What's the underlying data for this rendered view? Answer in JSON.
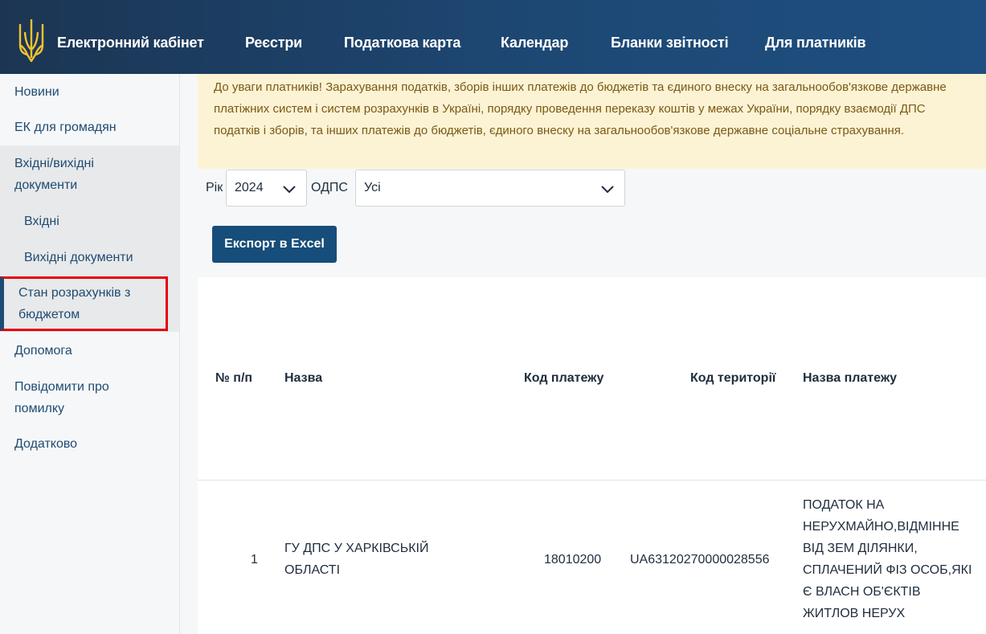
{
  "header": {
    "brand": "Електронний кабінет",
    "nav": [
      "Реєстри",
      "Податкова карта",
      "Календар",
      "Бланки звітності",
      "Для платників"
    ]
  },
  "sidebar": {
    "items": [
      {
        "label": "Новини"
      },
      {
        "label": "ЕК для громадян"
      },
      {
        "label_line1": "Вхідні/вихідні",
        "label_line2": "документи"
      },
      {
        "label": "Вхідні"
      },
      {
        "label": "Вихідні документи"
      },
      {
        "label_line1": "Стан розрахунків з",
        "label_line2": "бюджетом"
      },
      {
        "label": "Допомога"
      },
      {
        "label_line1": "Повідомити про",
        "label_line2": "помилку"
      },
      {
        "label": "Додатково"
      }
    ]
  },
  "notice": {
    "line1": "До уваги платників! Зарахування податків, зборів інших платежів до бюджетів та єдиного внеску на загальнообов'язкове державне",
    "line2": "платіжних систем і систем розрахунків в Україні, порядку проведення переказу коштів у межах України, порядку взаємодії ДПС",
    "line3": "податків і зборів, та інших платежів до бюджетів, єдиного внеску на загальнообов'язкове державне соціальне страхування."
  },
  "filters": {
    "year_label": "Рік",
    "year_value": "2024",
    "odps_label": "ОДПС",
    "odps_value": "Усі"
  },
  "export_button": "Експорт в Excel",
  "table": {
    "headers": [
      "№ п/п",
      "Назва",
      "Код платежу",
      "Код території",
      "Назва платежу"
    ],
    "rows": [
      {
        "num": "1",
        "name_line1": "ГУ ДПС У ХАРКІВСЬКІЙ",
        "name_line2": "ОБЛАСТІ",
        "payment_code": "18010200",
        "territory_code": "UA63120270000028556",
        "payment_name": [
          "ПОДАТОК НА",
          "НЕРУХМАЙНО,ВІДМІННЕ",
          "ВІД ЗЕМ ДІЛЯНКИ,",
          "СПЛАЧЕНИЙ ФІЗ ОСОБ,ЯКІ",
          "Є ВЛАСН ОБ'ЄКТІВ",
          "ЖИТЛОВ НЕРУХ"
        ]
      }
    ]
  },
  "colors": {
    "header_bg": "#1d4874",
    "notice_bg": "#fcf3d5",
    "button_bg": "#174d7a",
    "active_border": "#e3000f"
  }
}
